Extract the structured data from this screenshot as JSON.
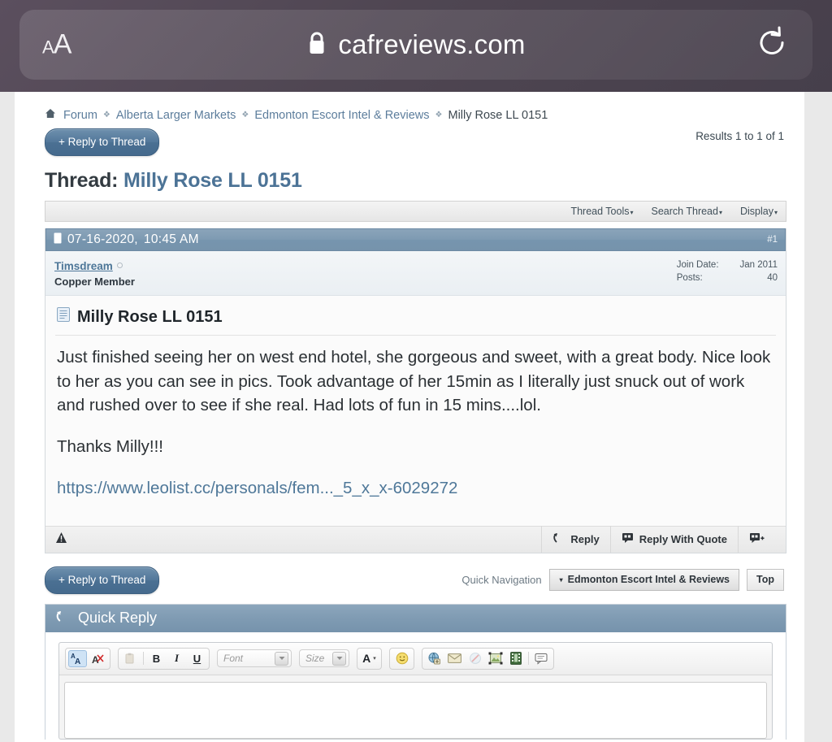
{
  "browser": {
    "text_size_small": "A",
    "text_size_large": "A",
    "lock_icon": "lock-icon",
    "url": "cafreviews.com",
    "reload_icon": "reload-icon"
  },
  "breadcrumb": {
    "home_icon": "home-icon",
    "separator": "❖",
    "items": [
      {
        "label": "Forum",
        "link": true
      },
      {
        "label": "Alberta Larger Markets",
        "link": true
      },
      {
        "label": "Edmonton Escort Intel & Reviews",
        "link": true
      },
      {
        "label": "Milly Rose LL 0151",
        "link": false
      }
    ]
  },
  "toolbar_top": {
    "reply_to_thread": "+ Reply to Thread",
    "results": "Results 1 to 1 of 1"
  },
  "thread": {
    "prefix": "Thread:",
    "title": "Milly Rose LL 0151"
  },
  "thread_tools": {
    "items": [
      {
        "label": "Thread Tools",
        "caret": "▾"
      },
      {
        "label": "Search Thread",
        "caret": "▾"
      },
      {
        "label": "Display",
        "caret": "▾"
      }
    ]
  },
  "post": {
    "icon": "post-marker-icon",
    "date": "07-16-2020,",
    "time": "10:45 AM",
    "number": "#1",
    "author": {
      "username": "Timsdream",
      "status_icon": "offline-status-icon",
      "usertitle": "Copper Member",
      "stats": [
        {
          "key": "Join Date:",
          "value": "Jan 2011"
        },
        {
          "key": "Posts:",
          "value": "40"
        }
      ]
    },
    "title_icon": "document-icon",
    "title": "Milly Rose LL 0151",
    "paragraphs": [
      "Just finished seeing her on west end hotel, she gorgeous and sweet, with a great body. Nice look to her as you can see in pics. Took advantage of her 15min as I literally just snuck out of work and rushed over to see if she real. Had lots of fun in 15 mins....lol.",
      "Thanks Milly!!!"
    ],
    "link_text": "https://www.leolist.cc/personals/fem..._5_x_x-6029272",
    "footer": {
      "report_icon": "report-triangle-icon",
      "buttons": [
        {
          "label": "Reply",
          "icon": "reply-arrow-icon"
        },
        {
          "label": "Reply With Quote",
          "icon": "quote-bubble-icon"
        },
        {
          "label": "",
          "icon": "multi-quote-add-icon"
        }
      ]
    }
  },
  "bottom_nav": {
    "reply_to_thread": "+ Reply to Thread",
    "quick_navigation_label": "Quick Navigation",
    "quick_navigation_value": "Edmonton Escort Intel & Reviews",
    "quick_navigation_caret": "▾",
    "top_label": "Top"
  },
  "quick_reply": {
    "icon": "reply-arrow-icon",
    "title": "Quick Reply",
    "toolbar": {
      "group1": [
        {
          "name": "wysiwyg-toggle-icon",
          "glyph": "A̲A",
          "active": true
        },
        {
          "name": "remove-formatting-icon",
          "glyph": "A",
          "active": false
        }
      ],
      "group2": [
        {
          "name": "paste-icon",
          "glyph": "❐",
          "disabled": true
        },
        {
          "name": "bold-icon",
          "glyph": "B"
        },
        {
          "name": "italic-icon",
          "glyph": "I"
        },
        {
          "name": "underline-icon",
          "glyph": "U"
        }
      ],
      "font_select": {
        "name": "font-select",
        "placeholder": "Font"
      },
      "size_select": {
        "name": "size-select",
        "placeholder": "Size"
      },
      "color_button": {
        "name": "font-color-icon",
        "glyph": "A",
        "caret": "▾"
      },
      "smiley_button": {
        "name": "smiley-icon",
        "glyph": "☺"
      },
      "group3": [
        {
          "name": "insert-link-icon",
          "glyph": "⊕"
        },
        {
          "name": "insert-email-icon",
          "glyph": "✉"
        },
        {
          "name": "remove-link-icon",
          "glyph": "●",
          "disabled": true
        },
        {
          "name": "insert-image-icon",
          "glyph": "▣"
        },
        {
          "name": "insert-video-icon",
          "glyph": "▓"
        },
        {
          "name": "insert-quote-icon",
          "glyph": "⬚"
        }
      ]
    },
    "message_value": ""
  }
}
